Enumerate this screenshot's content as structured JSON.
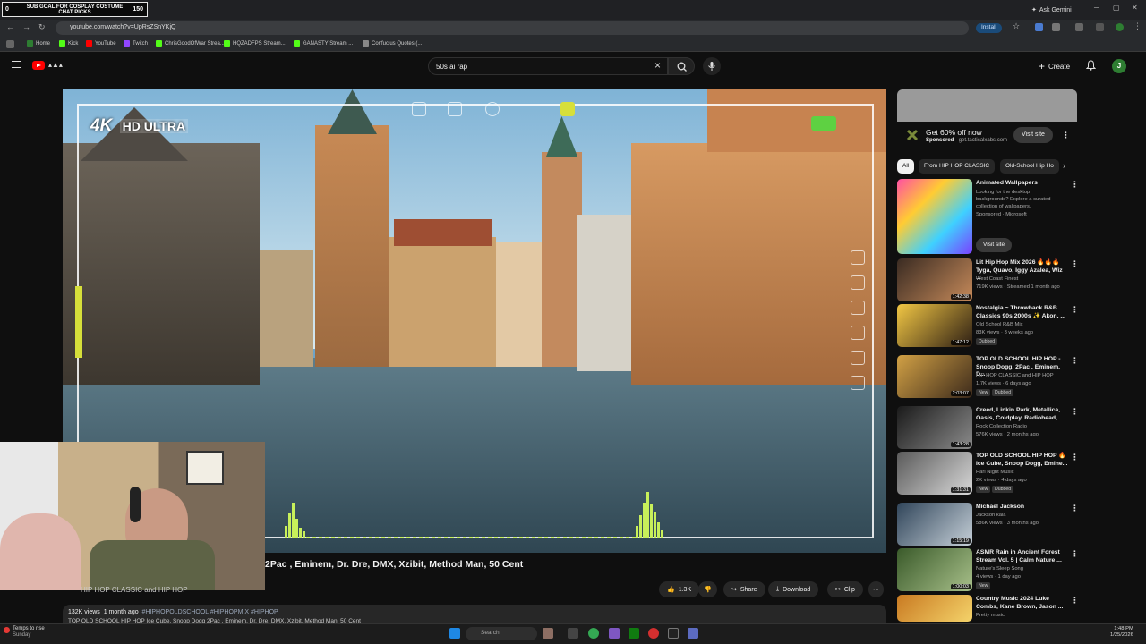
{
  "browser": {
    "overlay_goal_text": "SUB GOAL FOR COSPLAY COSTUME CHAT PICKS",
    "overlay_goal_left": "0",
    "overlay_goal_count": "150",
    "ask_gemini": "Ask Gemini",
    "url": "youtube.com/watch?v=UpRsZSnYKjQ",
    "install_label": "Install",
    "bookmarks": [
      {
        "label": "Home",
        "color": "#2e7d32"
      },
      {
        "label": "Kick",
        "color": "#53fc18"
      },
      {
        "label": "YouTube",
        "color": "#ff0000"
      },
      {
        "label": "Twitch",
        "color": "#9146ff"
      },
      {
        "label": "ChrisGoodOfWar Strea...",
        "color": "#53fc18"
      },
      {
        "label": "HQZADFPS Stream...",
        "color": "#53fc18"
      },
      {
        "label": "GANASTY Stream ...",
        "color": "#53fc18"
      },
      {
        "label": "Confucius Quotes (...",
        "color": "#888888"
      }
    ]
  },
  "youtube": {
    "search_query": "50s ai rap",
    "create_label": "Create",
    "avatar_letter": "J",
    "video": {
      "badge": "4K",
      "badge_quality": "HD ULTRA",
      "title": "2Pac , Eminem, Dr. Dre, DMX, Xzibit, Method Man, 50 Cent",
      "channel": "HIP HOP CLASSIC and HIP HOP",
      "likes": "1.3K",
      "share_label": "Share",
      "download_label": "Download",
      "clip_label": "Clip",
      "views": "132K views",
      "age": "1 month ago",
      "tags": "#HIPHOPOLDSCHOOL #HIPHOPMIX #HIPHOP",
      "desc_line": "TOP OLD SCHOOL HIP HOP Ice Cube, Snoop Dogg 2Pac , Eminem, Dr. Dre, DMX, Xzibit, Method Man, 50 Cent"
    },
    "ad": {
      "title": "Get 60% off now",
      "sponsored": "Sponsored",
      "domain": "get.tacticalxabs.com",
      "visit_label": "Visit site"
    },
    "chips": [
      {
        "label": "All",
        "active": true
      },
      {
        "label": "From HIP HOP CLASSIC",
        "active": false
      },
      {
        "label": "Old-School Hip Ho",
        "active": false
      }
    ],
    "recommendations": [
      {
        "title": "Animated Wallpapers",
        "channel": "Looking for the desktop backgrounds? Explore a curated collection of wallpapers.",
        "meta": "Sponsored · Microsoft",
        "duration": "",
        "badge": "",
        "badge2": "",
        "visit": "Visit site"
      },
      {
        "title": "Lit Hip Hop Mix 2026 🔥🔥🔥 Tyga, Quavo, Iggy Azalea, Wiz ...",
        "channel": "West Coast Finest",
        "meta": "719K views · Streamed 1 month ago",
        "duration": "1:42:38",
        "badge": "",
        "badge2": "",
        "visit": ""
      },
      {
        "title": "Nostalgia ~ Throwback R&B Classics 90s 2000s ✨ Akon, ...",
        "channel": "Old School R&B Mix",
        "meta": "83K views · 3 weeks ago",
        "duration": "1:47:12",
        "badge": "Dubbed",
        "badge2": "",
        "visit": ""
      },
      {
        "title": "TOP OLD SCHOOL HIP HOP - Snoop Dogg, 2Pac , Eminem, D...",
        "channel": "HIP HOP CLASSIC and HIP HOP",
        "meta": "1.7K views · 6 days ago",
        "duration": "2:03:07",
        "badge": "New",
        "badge2": "Dubbed",
        "visit": ""
      },
      {
        "title": "Creed, Linkin Park, Metallica, Oasis, Coldplay, Radiohead, ...",
        "channel": "Rock Collection Radio",
        "meta": "576K views · 2 months ago",
        "duration": "1:43:28",
        "badge": "",
        "badge2": "",
        "visit": ""
      },
      {
        "title": "TOP OLD SCHOOL HIP HOP 🔥 Ice Cube, Snoop Dogg, Emine...",
        "channel": "Hari Night Music",
        "meta": "2K views · 4 days ago",
        "duration": "1:31:31",
        "badge": "New",
        "badge2": "Dubbed",
        "visit": ""
      },
      {
        "title": "Michael Jackson",
        "channel": "Jackson kala",
        "meta": "586K views · 3 months ago",
        "duration": "1:15:19",
        "badge": "",
        "badge2": "",
        "visit": ""
      },
      {
        "title": "ASMR Rain in Ancient Forest Stream Vol. 5 | Calm Nature ...",
        "channel": "Nature's Sleep Song",
        "meta": "4 views · 1 day ago",
        "duration": "1:00:03",
        "badge": "New",
        "badge2": "",
        "visit": ""
      },
      {
        "title": "Country Music 2024 Luke Combs, Kane Brown, Jason ...",
        "channel": "Pretty music",
        "meta": "",
        "duration": "",
        "badge": "",
        "badge2": "",
        "visit": ""
      }
    ]
  },
  "taskbar": {
    "weather_line1": "Temps to rise",
    "weather_line2": "Sunday",
    "search_placeholder": "Search",
    "time": "1:48 PM",
    "date": "1/25/2026"
  },
  "colors": {
    "accent_red": "#ff0000",
    "hud_green": "#c8f05a",
    "bg": "#0f0f0f",
    "chip_bg": "#272727"
  }
}
